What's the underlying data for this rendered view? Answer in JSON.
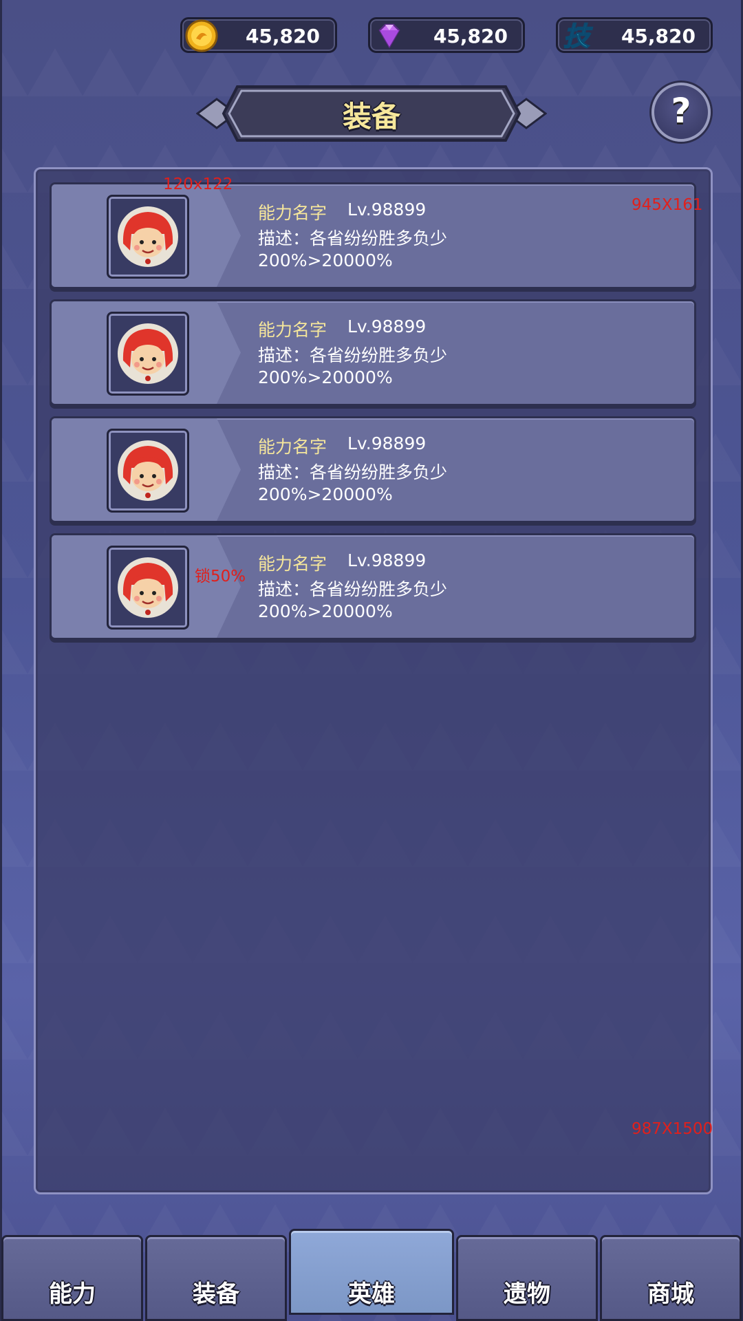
{
  "currencies": [
    {
      "icon": "gold-coin-icon",
      "value": "45,820"
    },
    {
      "icon": "purple-gem-icon",
      "value": "45,820"
    },
    {
      "icon": "skill-icon",
      "value": "45,820",
      "icon_text": "技"
    }
  ],
  "header": {
    "title": "装备",
    "help_label": "?"
  },
  "items": [
    {
      "name": "能力名字",
      "level": "Lv.98899",
      "desc": "描述：各省纷纷胜多负少",
      "stat": "200%>20000%"
    },
    {
      "name": "能力名字",
      "level": "Lv.98899",
      "desc": "描述：各省纷纷胜多负少",
      "stat": "200%>20000%"
    },
    {
      "name": "能力名字",
      "level": "Lv.98899",
      "desc": "描述：各省纷纷胜多负少",
      "stat": "200%>20000%"
    },
    {
      "name": "能力名字",
      "level": "Lv.98899",
      "desc": "描述：各省纷纷胜多负少",
      "stat": "200%>20000%"
    }
  ],
  "annotations": {
    "portrait_size": "120x122",
    "item_size": "945X161",
    "lock_note": "锁50%",
    "panel_size": "987X1500"
  },
  "nav": {
    "tabs": [
      {
        "label": "能力",
        "active": false
      },
      {
        "label": "装备",
        "active": false
      },
      {
        "label": "英雄",
        "active": true
      },
      {
        "label": "遗物",
        "active": false
      },
      {
        "label": "商城",
        "active": false
      }
    ]
  },
  "colors": {
    "accent_text": "#f6e79b",
    "note_red": "#e0201c",
    "active_tab": "#8fa8d8"
  }
}
